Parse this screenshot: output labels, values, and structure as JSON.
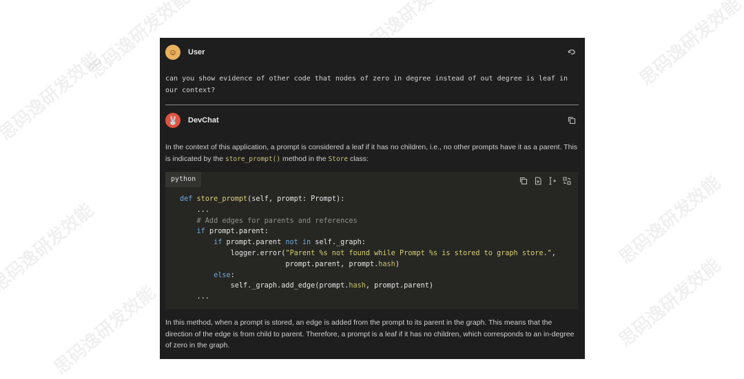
{
  "user_message": {
    "author": "User",
    "text": "can you show evidence of other code that nodes of zero in degree instead of out degree is leaf in our context?"
  },
  "bot_message": {
    "author": "DevChat",
    "intro_1": "In the context of this application, a prompt is considered a leaf if it has no children, i.e., no other prompts have it as a parent. This is indicated by the ",
    "intro_code_1": "store_prompt()",
    "intro_2": " method in the ",
    "intro_code_2": "Store",
    "intro_3": " class:",
    "code_language": "python",
    "code_lines": [
      [
        [
          "kw",
          "def "
        ],
        [
          "fn",
          "store_prompt"
        ],
        [
          "",
          "(self, prompt: Prompt):"
        ]
      ],
      [
        [
          "",
          "    ..."
        ]
      ],
      [
        [
          "cm",
          "    # Add edges for parents and references"
        ]
      ],
      [
        [
          "kw",
          "    if "
        ],
        [
          "",
          "prompt.parent:"
        ]
      ],
      [
        [
          "kw",
          "        if "
        ],
        [
          "",
          "prompt.parent "
        ],
        [
          "kw",
          "not in "
        ],
        [
          "",
          "self._graph:"
        ]
      ],
      [
        [
          "",
          "            logger.error("
        ],
        [
          "str",
          "\"Parent %s not found while Prompt %s is stored to graph store.\""
        ],
        [
          "",
          ","
        ]
      ],
      [
        [
          "",
          "                         prompt.parent, prompt."
        ],
        [
          "attr",
          "hash"
        ],
        [
          "",
          ")"
        ]
      ],
      [
        [
          "kw",
          "        else"
        ],
        [
          "",
          ":"
        ]
      ],
      [
        [
          "",
          "            self._graph.add_edge(prompt."
        ],
        [
          "attr",
          "hash"
        ],
        [
          "",
          ", prompt.parent)"
        ]
      ],
      [
        [
          "",
          "    ..."
        ]
      ]
    ],
    "outro": "In this method, when a prompt is stored, an edge is added from the prompt to its parent in the graph. This means that the direction of the edge is from child to parent. Therefore, a prompt is a leaf if it has no children, which corresponds to an in-degree of zero in the graph."
  },
  "watermark_text": "思码逸研发效能",
  "icons": {
    "user_avatar": "user-avatar-icon",
    "bot_avatar": "rabbit-avatar-icon",
    "user_action": "undo-icon",
    "bot_action": "copy-icon",
    "code_actions": [
      "copy-icon",
      "insert-file-icon",
      "insert-cursor-icon",
      "replace-icon"
    ]
  }
}
